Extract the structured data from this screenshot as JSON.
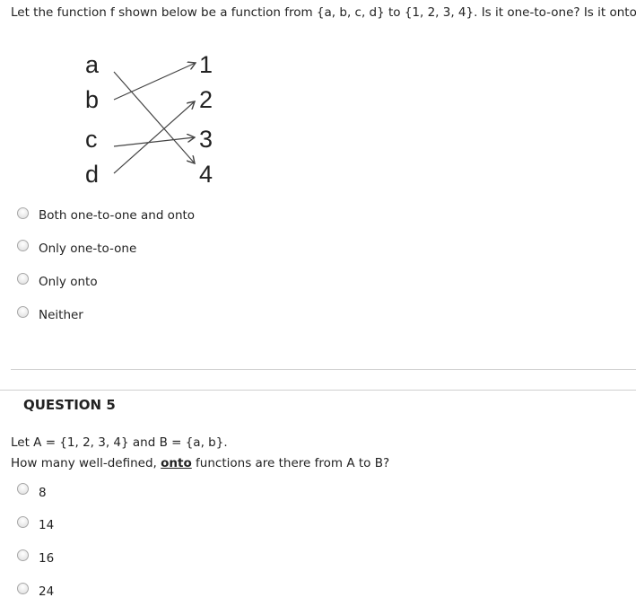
{
  "q4": {
    "prompt": "Let the function f shown below be a function from {a, b, c, d} to {1, 2, 3, 4}. Is it one-to-one? Is it onto?",
    "diagram": {
      "domain": [
        "a",
        "b",
        "c",
        "d"
      ],
      "codomain": [
        "1",
        "2",
        "3",
        "4"
      ],
      "mapping": {
        "a": "4",
        "b": "1",
        "c": "3",
        "d": "2"
      }
    },
    "options": [
      "Both one-to-one and onto",
      "Only one-to-one",
      "Only onto",
      "Neither"
    ]
  },
  "q5": {
    "title": "QUESTION 5",
    "line1": "Let A = {1, 2, 3, 4} and B = {a, b}.",
    "line2_pre": "How many well-defined, ",
    "line2_bold": "onto",
    "line2_post": " functions are there from A to B?",
    "options": [
      "8",
      "14",
      "16",
      "24"
    ]
  }
}
